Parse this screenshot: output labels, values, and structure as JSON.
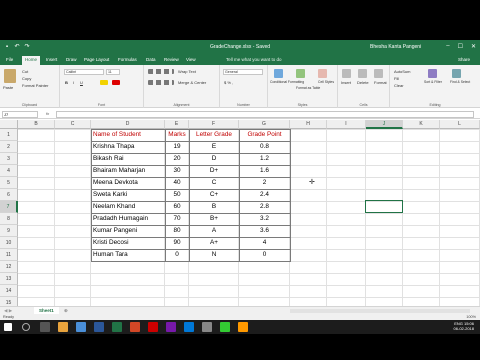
{
  "titlebar": {
    "title": "GradeChange.xlsx - Saved",
    "user": "Bhesha Kanta Pangeni",
    "min": "–",
    "max": "☐",
    "close": "✕"
  },
  "tabs": [
    "File",
    "Home",
    "Insert",
    "Draw",
    "Page Layout",
    "Formulas",
    "Data",
    "Review",
    "View"
  ],
  "active_tab": "Home",
  "tell_me": "Tell me what you want to do",
  "share": "Share",
  "ribbon": {
    "clipboard": {
      "paste": "Paste",
      "cut": "Cut",
      "copy": "Copy",
      "painter": "Format Painter",
      "label": "Clipboard"
    },
    "font": {
      "name": "Calibri",
      "size": "11",
      "label": "Font"
    },
    "alignment": {
      "wrap": "Wrap Text",
      "merge": "Merge & Center",
      "label": "Alignment"
    },
    "number": {
      "format": "General",
      "label": "Number"
    },
    "styles": {
      "conditional": "Conditional Formatting",
      "format_table": "Format as Table",
      "cell_styles": "Cell Styles",
      "label": "Styles"
    },
    "cells": {
      "insert": "Insert",
      "delete": "Delete",
      "format": "Format",
      "label": "Cells"
    },
    "editing": {
      "autosum": "AutoSum",
      "fill": "Fill",
      "clear": "Clear",
      "sort": "Sort & Filter",
      "find": "Find & Select",
      "label": "Editing"
    }
  },
  "formula_bar": {
    "namebox": "J7",
    "fx": "fx",
    "value": ""
  },
  "columns": [
    "B",
    "C",
    "D",
    "E",
    "F",
    "G",
    "H",
    "I",
    "J",
    "K",
    "L"
  ],
  "rows": [
    "1",
    "2",
    "3",
    "4",
    "5",
    "6",
    "7",
    "8",
    "9",
    "10",
    "11",
    "12",
    "13",
    "14",
    "15"
  ],
  "active_column": "J",
  "active_row": "7",
  "table": {
    "headers": [
      "Name of Student",
      "Marks",
      "Letter Grade",
      "Grade Point"
    ],
    "rows": [
      [
        "Krishna Thapa",
        "19",
        "E",
        "0.8"
      ],
      [
        "Bikash Rai",
        "20",
        "D",
        "1.2"
      ],
      [
        "Bhairam Maharjan",
        "30",
        "D+",
        "1.6"
      ],
      [
        "Meena Devkota",
        "40",
        "C",
        "2"
      ],
      [
        "Sweta Karki",
        "50",
        "C+",
        "2.4"
      ],
      [
        "Neelam Khand",
        "60",
        "B",
        "2.8"
      ],
      [
        "Pradadh Humagain",
        "70",
        "B+",
        "3.2"
      ],
      [
        "Kumar Pangeni",
        "80",
        "A",
        "3.6"
      ],
      [
        "Kristi Decosi",
        "90",
        "A+",
        "4"
      ],
      [
        "Human Tara",
        "0",
        "N",
        "0"
      ]
    ]
  },
  "sheet_tab": "Sheet1",
  "add_sheet": "⊕",
  "status": {
    "ready": "Ready",
    "zoom": "100%"
  },
  "clock": {
    "time": "15:06",
    "date": "06-02-2018",
    "lang": "ENG"
  },
  "colors": {
    "excel_green": "#217346",
    "header_text": "#c00000"
  }
}
